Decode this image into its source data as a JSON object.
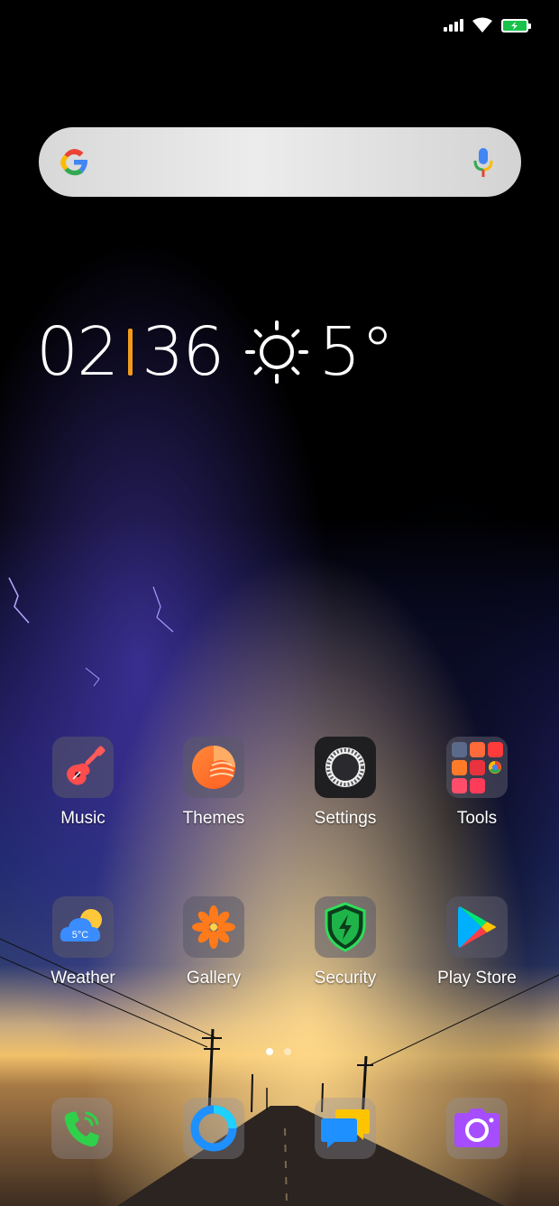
{
  "status_bar": {
    "icons": [
      "signal-icon",
      "wifi-icon",
      "battery-charging-icon"
    ],
    "battery_color": "#19c24a"
  },
  "search": {
    "icons": [
      "google-g-icon",
      "mic-icon"
    ]
  },
  "clock": {
    "hours": "02",
    "minutes": "36",
    "separator_color": "#f29b1a",
    "weather_icon": "sun-icon",
    "temperature": "5°"
  },
  "apps": [
    {
      "label": "Music",
      "icon": "guitar-icon"
    },
    {
      "label": "Themes",
      "icon": "themes-icon"
    },
    {
      "label": "Settings",
      "icon": "gear-icon"
    },
    {
      "label": "Tools",
      "icon": "folder-icon"
    },
    {
      "label": "Weather",
      "icon": "weather-icon",
      "badge": "5°C"
    },
    {
      "label": "Gallery",
      "icon": "flower-icon"
    },
    {
      "label": "Security",
      "icon": "shield-icon"
    },
    {
      "label": "Play Store",
      "icon": "play-store-icon"
    }
  ],
  "pager": {
    "pages": 2,
    "current": 1
  },
  "dock": [
    {
      "icon": "phone-icon"
    },
    {
      "icon": "browser-icon"
    },
    {
      "icon": "messages-icon"
    },
    {
      "icon": "camera-icon"
    }
  ]
}
